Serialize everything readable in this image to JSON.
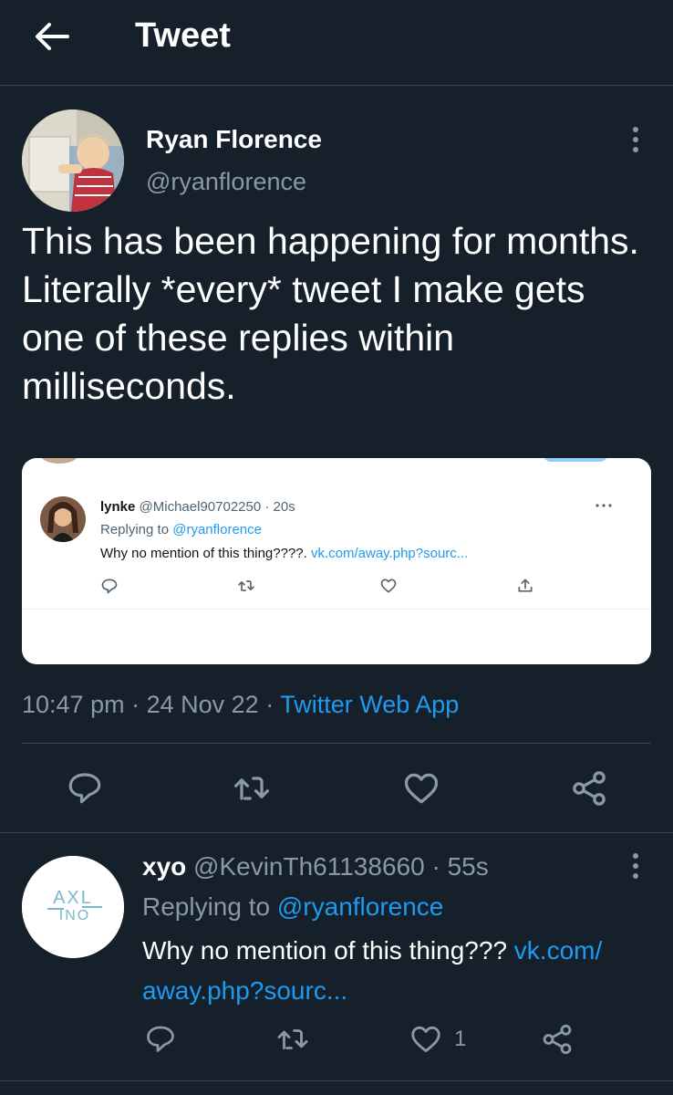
{
  "header": {
    "title": "Tweet"
  },
  "tweet": {
    "author_name": "Ryan Florence",
    "author_handle": "@ryanflorence",
    "text": "This has been happening for months. Literally *every* tweet I make gets one of these replies within milliseconds.",
    "timestamp": "10:47 pm",
    "date": "24 Nov 22",
    "separator": "·",
    "source": "Twitter Web App"
  },
  "embedded": {
    "name": "lynke",
    "handle": "@Michael90702250",
    "time": "20s",
    "replying_prefix": "Replying to",
    "replying_handle": "@ryanflorence",
    "text": "Why no mention of this thing????.",
    "link": "vk.com/away.php?sourc..."
  },
  "reply": {
    "name": "xyo",
    "handle": "@KevinTh61138660",
    "time": "55s",
    "replying_prefix": "Replying to",
    "replying_handle": "@ryanflorence",
    "text": "Why no mention of this thing???",
    "link": "vk.com/ away.php?sourc...",
    "like_count": "1",
    "avatar_logo": "AXL INO"
  },
  "colors": {
    "background": "#15202b",
    "accent": "#1d9bf0",
    "muted": "#8b98a5",
    "divider": "#38444d"
  },
  "icons": [
    "back-arrow-icon",
    "more-vertical-icon",
    "reply-icon",
    "retweet-icon",
    "like-icon",
    "share-icon",
    "upload-icon",
    "more-horizontal-icon"
  ]
}
